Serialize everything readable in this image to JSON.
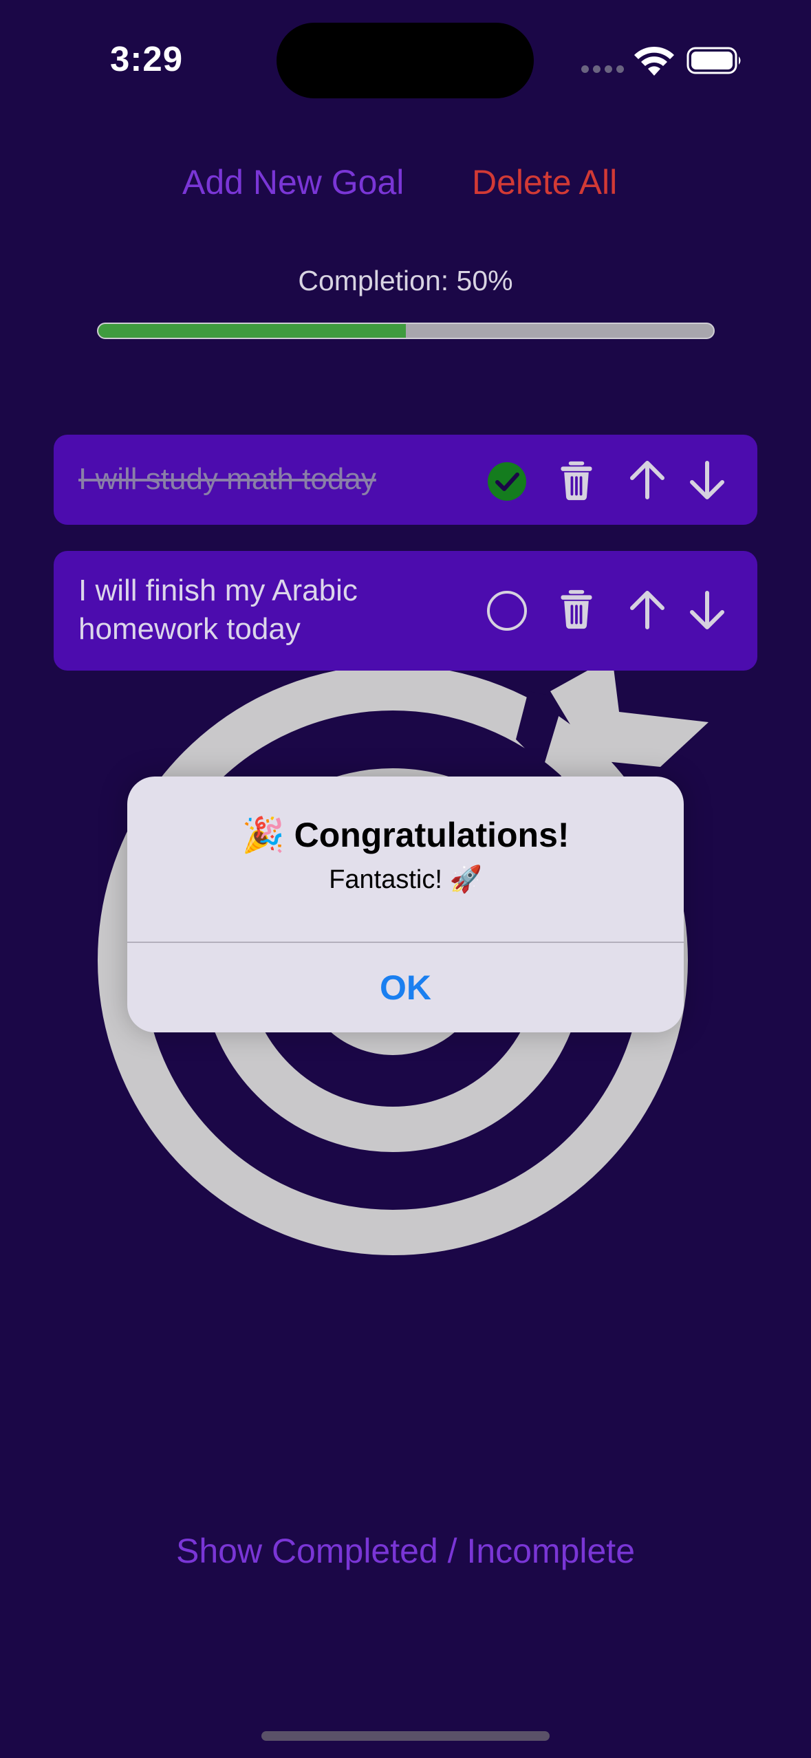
{
  "status_bar": {
    "time": "3:29"
  },
  "actions": {
    "add_goal_label": "Add New Goal",
    "delete_all_label": "Delete All"
  },
  "progress": {
    "label": "Completion: 50%",
    "fraction": 0.5
  },
  "goals": [
    {
      "text": "I will study math today",
      "completed": true
    },
    {
      "text": "I will finish my Arabic homework today",
      "completed": false
    }
  ],
  "alert": {
    "title": "🎉 Congratulations!",
    "message": "Fantastic! 🚀",
    "ok_label": "OK"
  },
  "footer": {
    "toggle_label": "Show Completed / Incomplete"
  },
  "colors": {
    "background": "#1b0747",
    "card": "#4c0cae",
    "accent_purple": "#7a36d6",
    "danger_red": "#d23a35",
    "progress_green": "#3f9b3f",
    "alert_blue": "#1a7ff0"
  },
  "icons": {
    "complete": "checkmark-circle-icon",
    "incomplete": "circle-icon",
    "delete": "trash-icon",
    "move_up": "arrow-up-icon",
    "move_down": "arrow-down-icon"
  }
}
